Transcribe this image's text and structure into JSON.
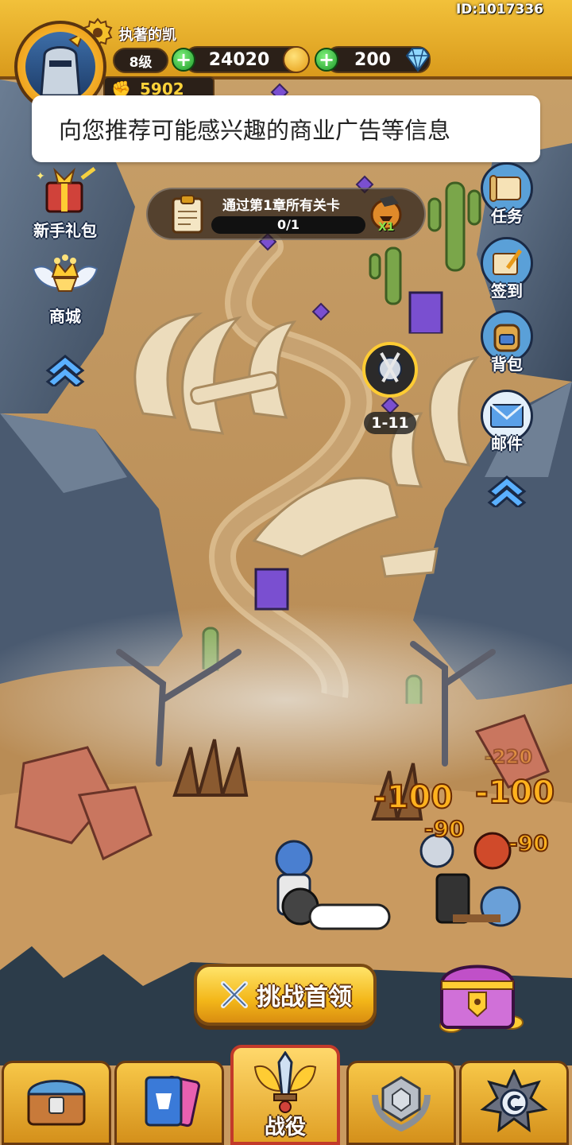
{
  "player": {
    "id": "ID:1017336",
    "name": "执著的凯",
    "level": "8级",
    "power": "5902"
  },
  "currency": {
    "gold": "24020",
    "gems": "200"
  },
  "ad_banner": {
    "text": "向您推荐可能感兴趣的商业广告等信息"
  },
  "left_menu": {
    "newbie_pack": "新手礼包",
    "shop": "商城"
  },
  "right_menu": {
    "tasks": "任务",
    "signin": "签到",
    "backpack": "背包",
    "mail": "邮件"
  },
  "quest": {
    "title": "通过第1章所有关卡",
    "progress": "0/1",
    "reward": "X1"
  },
  "stage": {
    "current": "1-11"
  },
  "battle": {
    "damage": [
      "-100",
      "-100",
      "-90",
      "-90",
      "-220"
    ]
  },
  "challenge_button": {
    "label": "挑战首领"
  },
  "bottom_nav": {
    "active": "战役",
    "active_label": "战役"
  },
  "colors": {
    "gold_bar": "#f2c13a",
    "plus_green": "#1e9a2a",
    "damage_orange": "#ffb21e",
    "active_tab_border": "#c23a2a"
  }
}
